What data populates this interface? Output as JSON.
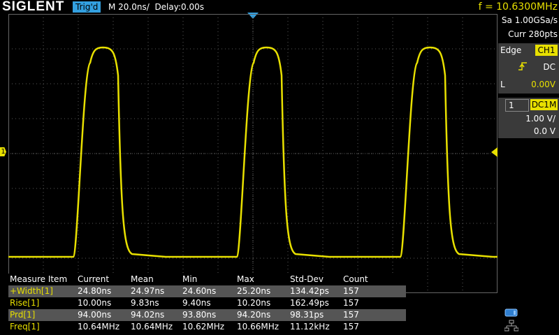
{
  "header": {
    "brand": "SIGLENT",
    "trigger_status": "Trig'd",
    "timebase": "M 20.0ns/",
    "delay": "Delay:0.00s",
    "frequency": "f = 10.6300MHz"
  },
  "acquisition": {
    "sample_rate": "Sa 1.00GSa/s",
    "memory_depth": "Curr 280pts"
  },
  "trigger": {
    "type": "Edge",
    "source": "CH1",
    "slope_icon": "rising-edge-icon",
    "coupling": "DC",
    "level_label": "L",
    "level": "0.00V"
  },
  "channel": {
    "number": "1",
    "coupling": "DC1M",
    "scale": "1.00 V/",
    "offset": "0.0 V",
    "marker_label": "1"
  },
  "measurements": {
    "headers": [
      "Measure Item",
      "Current",
      "Mean",
      "Min",
      "Max",
      "Std-Dev",
      "Count"
    ],
    "rows": [
      [
        "+Width[1]",
        "24.80ns",
        "24.97ns",
        "24.60ns",
        "25.20ns",
        "134.42ps",
        "157"
      ],
      [
        "Rise[1]",
        "10.00ns",
        "9.83ns",
        "9.40ns",
        "10.20ns",
        "162.49ps",
        "157"
      ],
      [
        "Prd[1]",
        "94.00ns",
        "94.02ns",
        "93.80ns",
        "94.20ns",
        "98.31ps",
        "157"
      ],
      [
        "Freq[1]",
        "10.64MHz",
        "10.64MHz",
        "10.62MHz",
        "10.66MHz",
        "11.12kHz",
        "157"
      ]
    ]
  },
  "status_icons": [
    "usb-icon",
    "network-icon"
  ],
  "colors": {
    "trace": "#e8e000",
    "accent": "#33a0e0",
    "grid": "#555555"
  }
}
